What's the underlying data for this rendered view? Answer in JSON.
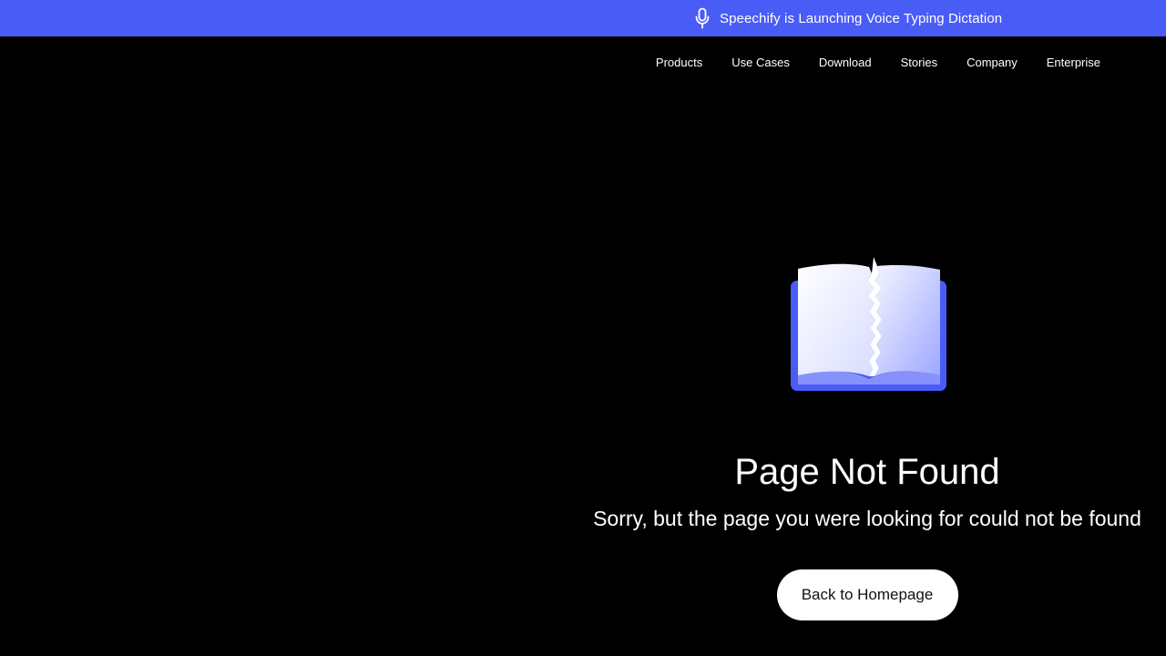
{
  "banner": {
    "icon": "microphone-icon",
    "text": "Speechify is Launching Voice Typing Dictation",
    "background_color": "#4a5cf6"
  },
  "nav": {
    "items": [
      {
        "label": "Products"
      },
      {
        "label": "Use Cases"
      },
      {
        "label": "Download"
      },
      {
        "label": "Stories"
      },
      {
        "label": "Company"
      },
      {
        "label": "Enterprise"
      }
    ]
  },
  "main": {
    "illustration": "torn-book-icon",
    "title": "Page Not Found",
    "subtitle": "Sorry, but the page you were looking for could not be found",
    "button_label": "Back to Homepage"
  },
  "colors": {
    "accent": "#4a5cf6",
    "background": "#000000",
    "text": "#ffffff"
  }
}
